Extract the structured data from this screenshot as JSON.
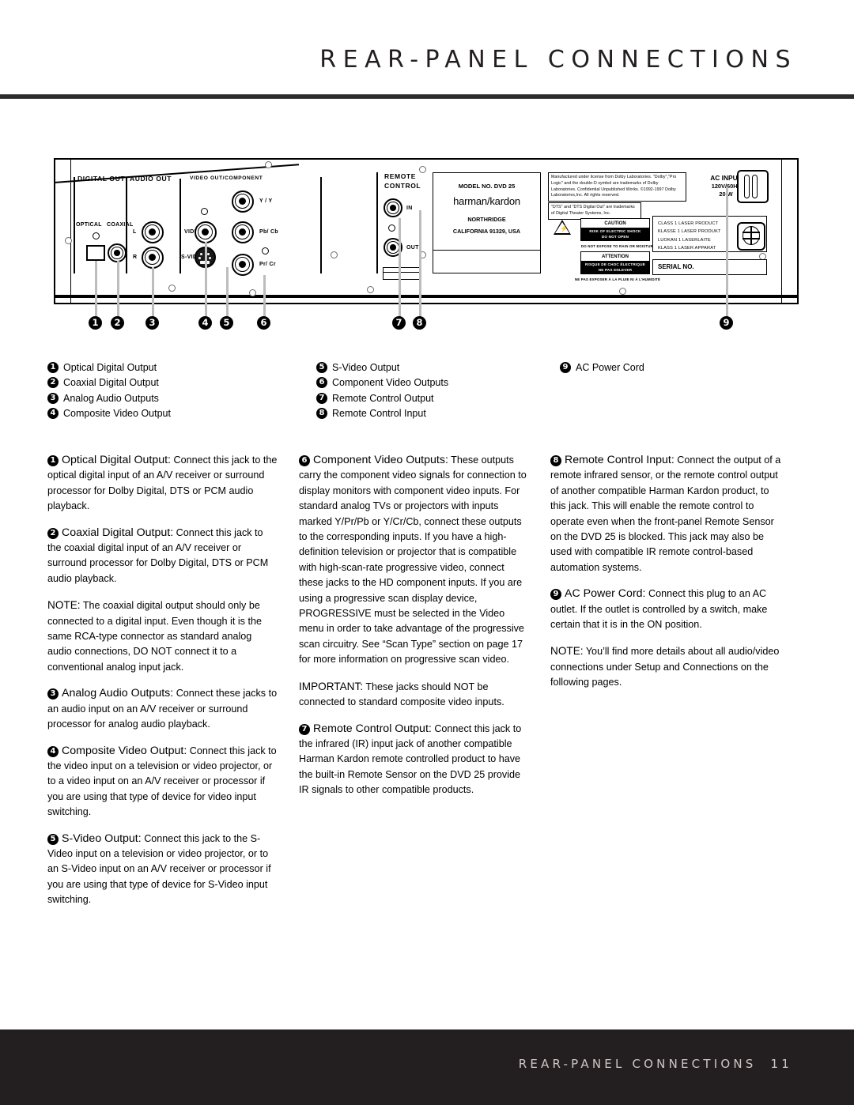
{
  "header": {
    "title": "REAR-PANEL CONNECTIONS"
  },
  "footer": {
    "title": "REAR-PANEL CONNECTIONS",
    "page_number": "11"
  },
  "panel": {
    "sections": {
      "digital_out": "DIGITAL OUT",
      "audio_out": "AUDIO OUT",
      "video_out_component": "VIDEO OUT/COMPONENT",
      "remote_control_line1": "REMOTE",
      "remote_control_line2": "CONTROL",
      "ac_input_line1": "AC INPUT",
      "ac_input_line2": "120V/60Hz",
      "ac_input_line3": "20 W"
    },
    "jacks": {
      "optical": "OPTICAL",
      "coaxial": "COAXIAL",
      "audio_left": "L",
      "audio_right": "R",
      "video": "VIDEO",
      "svideo": "S-VIDEO",
      "comp_y": "Y / Y",
      "comp_pb": "Pb/ Cb",
      "comp_pr": "Pr/ Cr",
      "remote_in": "IN",
      "remote_out": "OUT"
    },
    "brand_plate": {
      "model": "MODEL NO. DVD 25",
      "brand": "harman/kardon",
      "city": "NORTHRIDGE",
      "address": "CALIFORNIA 91329, USA"
    },
    "notices": {
      "dolby": "Manufactured under license from Dolby Laboratories. \"Dolby\",\"Pro Logic\" and the double-D symbol are trademarks of Dolby Laboratories.  Confidential Unpublished Works. ©1992-1997 Dolby Laboratories,Inc. All rights reserved.",
      "dts": "\"DTS\" and \"DTS Digital Out\" are trademarks of Digital Theater Systems, Inc.",
      "caution_title": "CAUTION",
      "caution_line1": "RISK OF ELECTRIC SHOCK",
      "caution_line2": "DO NOT OPEN",
      "caution_sub": "DO NOT EXPOSE TO RAIN OR MOISTURE",
      "attention_title": "ATTENTION",
      "attention_line1": "RISQUE DE CHOC ÉLECTRIQUE",
      "attention_line2": "NE PAS ENLEVER",
      "attention_sub": "NE PAS EXPOSER À LA PLUIE NI À L'HUMIDITÉ",
      "laser_line1": "CLASS  1   LASER  PRODUCT",
      "laser_line2": "KLASSE  1   LASER  PRODUKT",
      "laser_line3": "LUOKAN  1   LASERLAITE",
      "laser_line4": "KLASS  1   LASER APPARAT",
      "serial": "SERIAL NO."
    },
    "callouts": [
      "1",
      "2",
      "3",
      "4",
      "5",
      "6",
      "7",
      "8",
      "9"
    ]
  },
  "legend": {
    "columns": [
      [
        {
          "num": "1",
          "label": "Optical Digital Output"
        },
        {
          "num": "2",
          "label": "Coaxial Digital Output"
        },
        {
          "num": "3",
          "label": "Analog Audio Outputs"
        },
        {
          "num": "4",
          "label": "Composite Video Output"
        }
      ],
      [
        {
          "num": "5",
          "label": "S-Video Output"
        },
        {
          "num": "6",
          "label": "Component Video Outputs"
        },
        {
          "num": "7",
          "label": "Remote Control Output"
        },
        {
          "num": "8",
          "label": "Remote Control Input"
        }
      ],
      [
        {
          "num": "9",
          "label": "AC Power Cord"
        }
      ]
    ]
  },
  "body": {
    "column1": [
      {
        "num": "1",
        "lead": "Optical Digital Output:",
        "text": " Connect this jack to the optical digital input of an A/V receiver or surround processor for Dolby Digital, DTS or PCM audio playback."
      },
      {
        "num": "2",
        "lead": "Coaxial Digital Output:",
        "text": " Connect this jack to the coaxial digital input of an A/V receiver or surround processor for Dolby Digital, DTS or PCM audio playback."
      },
      {
        "num": "",
        "lead": "NOTE:",
        "text": " The coaxial digital output should only be connected to a digital input. Even though it is the same RCA-type connector as standard analog audio connections, DO NOT connect it to a conventional analog input jack."
      },
      {
        "num": "3",
        "lead": "Analog Audio Outputs:",
        "text": " Connect these jacks to an audio input on an A/V receiver or surround processor for analog audio playback."
      },
      {
        "num": "4",
        "lead": "Composite Video Output:",
        "text": " Connect this jack to the video input on a television or video projector, or to a video input on an A/V receiver or processor if you are using that type of device for video input switching."
      },
      {
        "num": "5",
        "lead": "S-Video Output:",
        "text": " Connect this jack to the S-Video input on a television or video projector, or to an S-Video input on an A/V receiver or processor if you are using that type of device for S-Video input switching."
      }
    ],
    "column2": [
      {
        "num": "6",
        "lead": "Component Video Outputs:",
        "text": " These outputs carry the component video signals for connection to display monitors with component video inputs. For standard analog TVs or projectors with inputs marked Y/Pr/Pb or Y/Cr/Cb, connect these outputs to the corresponding inputs. If you have a high-definition television or projector that is compatible with high-scan-rate progressive video, connect these jacks to the HD component inputs. If you are using a progressive scan display device, PROGRESSIVE must be selected in the Video menu in order to take advantage of the progressive scan circuitry. See “Scan Type” section on page 17 for more information on progressive scan video."
      },
      {
        "num": "",
        "lead": "IMPORTANT:",
        "text": " These jacks should NOT be connected to standard composite video inputs."
      },
      {
        "num": "7",
        "lead": "Remote Control Output:",
        "text": " Connect this jack to the infrared (IR) input jack of another compatible Harman Kardon remote controlled product to have the built-in Remote Sensor on the DVD 25 provide IR signals to other compatible products."
      }
    ],
    "column3": [
      {
        "num": "8",
        "lead": "Remote Control Input:",
        "text": " Connect the output of a remote infrared sensor, or the remote control output of another compatible Harman Kardon product, to this jack. This will enable the remote control to operate even when the front-panel Remote Sensor on the DVD 25 is blocked. This jack may also be used with compatible IR remote control-based automation systems."
      },
      {
        "num": "9",
        "lead": "AC Power Cord:",
        "text": " Connect this plug to an AC outlet. If the outlet is controlled by a switch, make certain that it is in the ON position."
      },
      {
        "num": "",
        "lead": "NOTE:",
        "text": " You’ll find more details about all audio/video connections under Setup and Connections on the following pages."
      }
    ]
  }
}
